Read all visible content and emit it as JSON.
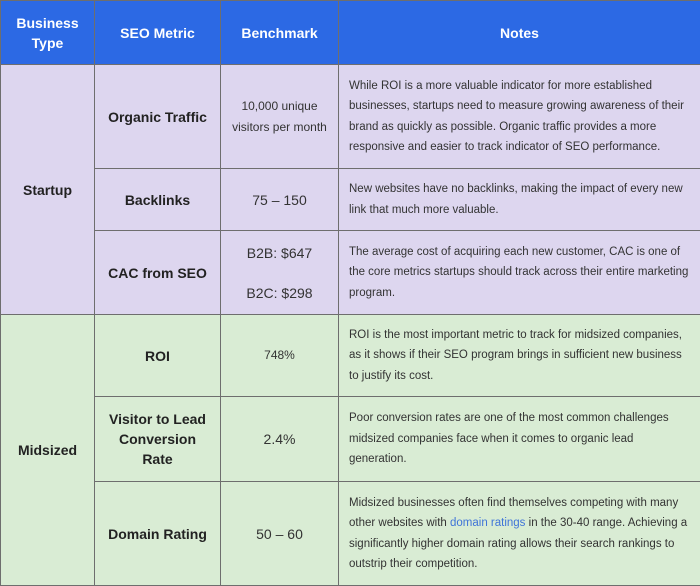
{
  "headers": {
    "business_type": "Business Type",
    "seo_metric": "SEO Metric",
    "benchmark": "Benchmark",
    "notes": "Notes"
  },
  "groups": [
    {
      "type": "Startup",
      "rows": [
        {
          "metric": "Organic Traffic",
          "benchmark": "10,000 unique visitors per month",
          "notes": "While ROI is a more valuable indicator for more established businesses, startups need to measure growing awareness of their brand as quickly as possible. Organic traffic provides a more responsive and easier to track indicator of SEO performance."
        },
        {
          "metric": "Backlinks",
          "benchmark": "75 – 150",
          "notes": "New websites have no backlinks, making the impact of every new link that much more valuable."
        },
        {
          "metric": "CAC from SEO",
          "benchmark_b2b": "B2B: $647",
          "benchmark_b2c": "B2C: $298",
          "notes": "The average cost of acquiring each new customer, CAC is one of the core metrics startups should track across their entire marketing program."
        }
      ]
    },
    {
      "type": "Midsized",
      "rows": [
        {
          "metric": "ROI",
          "benchmark": "748%",
          "notes": "ROI is the most important metric to track for midsized companies, as it shows if their SEO program brings in sufficient new business to justify its cost."
        },
        {
          "metric": "Visitor to Lead Conversion Rate",
          "benchmark": "2.4%",
          "notes": "Poor conversion rates are one of the most common challenges midsized companies face when it comes to organic lead generation."
        },
        {
          "metric": "Domain Rating",
          "benchmark": "50 – 60",
          "notes_before": "Midsized businesses often find themselves competing with many other websites with ",
          "notes_link": "domain ratings",
          "notes_after": " in the 30-40 range. Achieving a significantly higher domain rating allows their search rankings to outstrip their competition."
        }
      ]
    }
  ],
  "colors": {
    "header_bg": "#2c69e4",
    "startup_bg": "#ddd6ef",
    "midsized_bg": "#d9ecd4",
    "link": "#3f74d8"
  }
}
